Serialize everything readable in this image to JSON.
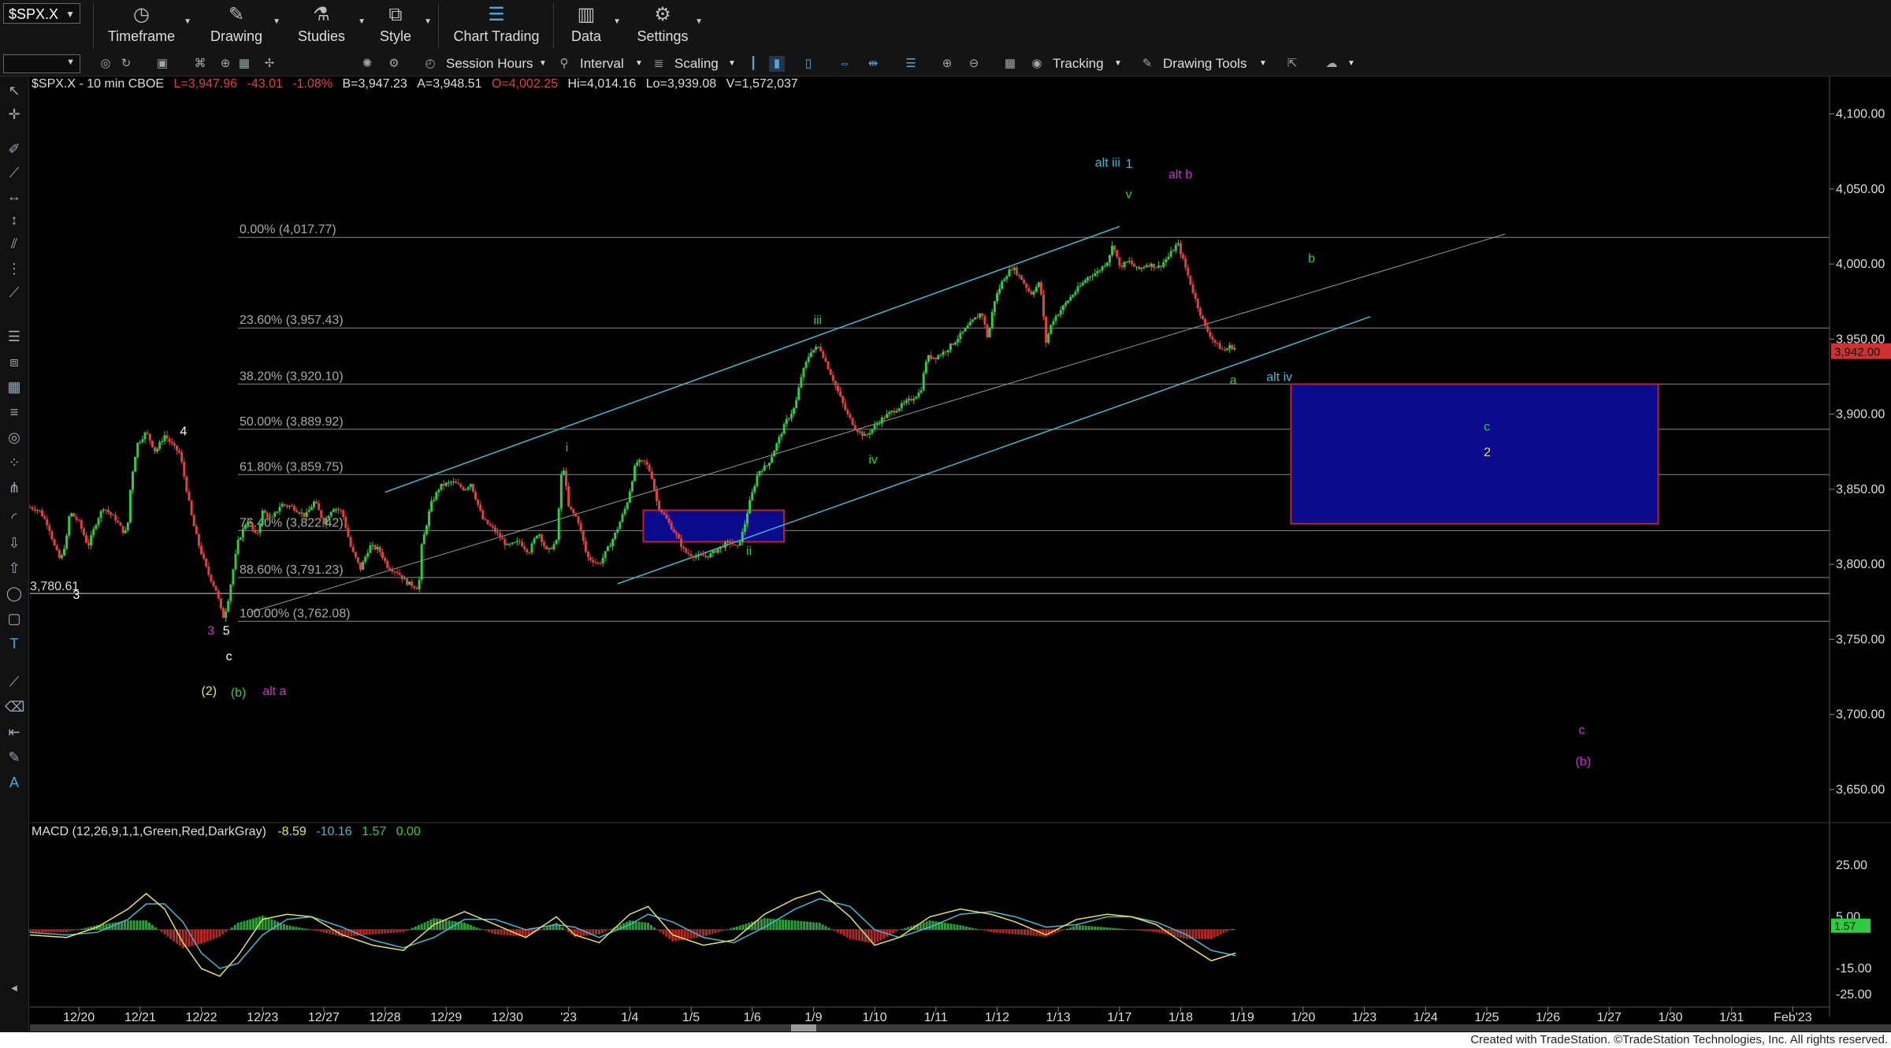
{
  "toolbar": {
    "symbol": "$SPX.X",
    "buttons": [
      {
        "label": "Timeframe",
        "icon": "clock-icon"
      },
      {
        "label": "Drawing",
        "icon": "pen-icon"
      },
      {
        "label": "Studies",
        "icon": "flask-icon"
      },
      {
        "label": "Style",
        "icon": "style-icon"
      },
      {
        "label": "Chart Trading",
        "icon": "chart-trading-icon"
      },
      {
        "label": "Data",
        "icon": "bar-chart-icon"
      },
      {
        "label": "Settings",
        "icon": "gear-icon"
      }
    ]
  },
  "toolbar2": {
    "session": "Session Hours",
    "interval": "Interval",
    "scaling": "Scaling",
    "tracking": "Tracking",
    "drawing_tools": "Drawing Tools"
  },
  "header": {
    "symbol_info": "$SPX.X - 10 min  CBOE",
    "last": "L=3,947.96",
    "change": "-43.01",
    "pct": "-1.08%",
    "bid": "B=3,947.23",
    "ask": "A=3,948.51",
    "open": "O=4,002.25",
    "high": "Hi=4,014.16",
    "low": "Lo=3,939.08",
    "volume": "V=1,572,037"
  },
  "macd_header": {
    "name": "MACD (12,26,9,1,1,Green,Red,DarkGray)",
    "v1": "-8.59",
    "v2": "-10.16",
    "v3": "1.57",
    "v4": "0.00"
  },
  "footer": "Created with TradeStation. ©TradeStation Technologies, Inc. All rights reserved.",
  "colors": {
    "up": "#2ecc40",
    "down": "#e04040",
    "teal": "#44b8d0",
    "magenta": "#d030d0",
    "yellow": "#e8e060",
    "box": "#0a0a8c",
    "boxBorder": "#c02030",
    "lastPrice": "#d03030"
  },
  "chart_data": {
    "type": "candlestick",
    "ylim": [
      3630,
      4115
    ],
    "y_ticks": [
      "4,100.00",
      "4,050.00",
      "4,000.00",
      "3,950.00",
      "3,900.00",
      "3,850.00",
      "3,800.00",
      "3,750.00",
      "3,700.00",
      "3,650.00"
    ],
    "y_tick_values": [
      4100,
      4050,
      4000,
      3950,
      3900,
      3850,
      3800,
      3750,
      3700,
      3650
    ],
    "last_price": 3942,
    "last_price_label": "3,942.00",
    "x_labels": [
      "12/20",
      "12/21",
      "12/22",
      "12/23",
      "12/27",
      "12/28",
      "12/29",
      "12/30",
      "'23",
      "1/4",
      "1/5",
      "1/6",
      "1/9",
      "1/10",
      "1/11",
      "1/12",
      "1/13",
      "1/17",
      "1/18",
      "1/19",
      "1/20",
      "1/23",
      "1/24",
      "1/25",
      "1/26",
      "1/27",
      "1/30",
      "1/31",
      "Feb'23"
    ],
    "x_label_pos": [
      0.2,
      1.2,
      2.2,
      3.2,
      4.2,
      5.2,
      6.2,
      7.2,
      8.2,
      9.2,
      10.2,
      11.2,
      12.2,
      13.2,
      14.2,
      15.2,
      16.2,
      17.2,
      18.2,
      19.2,
      20.2,
      21.2,
      22.2,
      23.2,
      24.2,
      25.2,
      26.2,
      27.2,
      28.2
    ],
    "x_range": [
      -0.6,
      28.8
    ],
    "price_path": [
      [
        -0.6,
        3838
      ],
      [
        -0.45,
        3836
      ],
      [
        -0.3,
        3826
      ],
      [
        -0.2,
        3812
      ],
      [
        -0.1,
        3802
      ],
      [
        0.0,
        3818
      ],
      [
        0.05,
        3835
      ],
      [
        0.2,
        3828
      ],
      [
        0.35,
        3812
      ],
      [
        0.5,
        3830
      ],
      [
        0.6,
        3838
      ],
      [
        0.8,
        3830
      ],
      [
        0.95,
        3820
      ],
      [
        1.0,
        3828
      ],
      [
        1.05,
        3855
      ],
      [
        1.15,
        3880
      ],
      [
        1.3,
        3888
      ],
      [
        1.45,
        3875
      ],
      [
        1.6,
        3886
      ],
      [
        1.75,
        3878
      ],
      [
        1.85,
        3874
      ],
      [
        1.95,
        3852
      ],
      [
        2.05,
        3830
      ],
      [
        2.15,
        3814
      ],
      [
        2.3,
        3795
      ],
      [
        2.45,
        3782
      ],
      [
        2.55,
        3764
      ],
      [
        2.62,
        3772
      ],
      [
        2.7,
        3792
      ],
      [
        2.8,
        3815
      ],
      [
        2.95,
        3830
      ],
      [
        3.1,
        3818
      ],
      [
        3.2,
        3835
      ],
      [
        3.35,
        3830
      ],
      [
        3.5,
        3840
      ],
      [
        3.7,
        3838
      ],
      [
        3.9,
        3832
      ],
      [
        4.05,
        3842
      ],
      [
        4.2,
        3828
      ],
      [
        4.35,
        3838
      ],
      [
        4.5,
        3835
      ],
      [
        4.65,
        3810
      ],
      [
        4.8,
        3797
      ],
      [
        4.95,
        3812
      ],
      [
        5.1,
        3810
      ],
      [
        5.25,
        3798
      ],
      [
        5.4,
        3795
      ],
      [
        5.55,
        3788
      ],
      [
        5.75,
        3784
      ],
      [
        5.8,
        3812
      ],
      [
        5.95,
        3840
      ],
      [
        6.1,
        3852
      ],
      [
        6.3,
        3855
      ],
      [
        6.5,
        3850
      ],
      [
        6.6,
        3854
      ],
      [
        6.8,
        3830
      ],
      [
        7.0,
        3822
      ],
      [
        7.2,
        3812
      ],
      [
        7.4,
        3815
      ],
      [
        7.55,
        3808
      ],
      [
        7.7,
        3822
      ],
      [
        7.85,
        3808
      ],
      [
        8.0,
        3815
      ],
      [
        8.1,
        3870
      ],
      [
        8.2,
        3838
      ],
      [
        8.35,
        3830
      ],
      [
        8.5,
        3805
      ],
      [
        8.7,
        3800
      ],
      [
        8.9,
        3815
      ],
      [
        9.0,
        3824
      ],
      [
        9.15,
        3840
      ],
      [
        9.3,
        3868
      ],
      [
        9.45,
        3868
      ],
      [
        9.55,
        3860
      ],
      [
        9.65,
        3840
      ],
      [
        9.8,
        3830
      ],
      [
        9.95,
        3820
      ],
      [
        10.1,
        3808
      ],
      [
        10.3,
        3805
      ],
      [
        10.5,
        3806
      ],
      [
        10.7,
        3812
      ],
      [
        10.85,
        3815
      ],
      [
        10.95,
        3810
      ],
      [
        11.05,
        3822
      ],
      [
        11.15,
        3840
      ],
      [
        11.3,
        3862
      ],
      [
        11.45,
        3866
      ],
      [
        11.6,
        3880
      ],
      [
        11.75,
        3895
      ],
      [
        11.9,
        3905
      ],
      [
        12.0,
        3925
      ],
      [
        12.15,
        3942
      ],
      [
        12.3,
        3945
      ],
      [
        12.45,
        3930
      ],
      [
        12.6,
        3915
      ],
      [
        12.75,
        3900
      ],
      [
        12.9,
        3890
      ],
      [
        13.05,
        3885
      ],
      [
        13.2,
        3892
      ],
      [
        13.35,
        3898
      ],
      [
        13.5,
        3902
      ],
      [
        13.65,
        3906
      ],
      [
        13.8,
        3910
      ],
      [
        13.95,
        3915
      ],
      [
        14.05,
        3938
      ],
      [
        14.2,
        3938
      ],
      [
        14.35,
        3942
      ],
      [
        14.5,
        3948
      ],
      [
        14.65,
        3955
      ],
      [
        14.8,
        3962
      ],
      [
        14.95,
        3968
      ],
      [
        15.05,
        3950
      ],
      [
        15.15,
        3975
      ],
      [
        15.3,
        3990
      ],
      [
        15.45,
        3998
      ],
      [
        15.6,
        3990
      ],
      [
        15.75,
        3980
      ],
      [
        15.9,
        3988
      ],
      [
        16.0,
        3948
      ],
      [
        16.1,
        3962
      ],
      [
        16.25,
        3970
      ],
      [
        16.4,
        3978
      ],
      [
        16.55,
        3985
      ],
      [
        16.7,
        3992
      ],
      [
        16.85,
        3995
      ],
      [
        17.0,
        4002
      ],
      [
        17.1,
        4014
      ],
      [
        17.2,
        3998
      ],
      [
        17.35,
        4002
      ],
      [
        17.5,
        3996
      ],
      [
        17.65,
        4000
      ],
      [
        17.85,
        3998
      ],
      [
        18.0,
        4005
      ],
      [
        18.15,
        4014
      ],
      [
        18.3,
        3995
      ],
      [
        18.45,
        3975
      ],
      [
        18.6,
        3958
      ],
      [
        18.75,
        3948
      ],
      [
        18.9,
        3942
      ],
      [
        19.0,
        3945
      ],
      [
        19.1,
        3944
      ]
    ],
    "levels": [
      {
        "label": "0.00% (4,017.77)",
        "value": 4017.77
      },
      {
        "label": "23.60% (3,957.43)",
        "value": 3957.43
      },
      {
        "label": "38.20% (3,920.10)",
        "value": 3920.1
      },
      {
        "label": "50.00% (3,889.92)",
        "value": 3889.92
      },
      {
        "label": "61.80% (3,859.75)",
        "value": 3859.75
      },
      {
        "label": "76.40% (3,822.42)",
        "value": 3822.42
      },
      {
        "label": "88.60% (3,791.23)",
        "value": 3791.23
      },
      {
        "label": "100.00% (3,762.08)",
        "value": 3762.08
      }
    ],
    "hline": {
      "label": "3,780.61",
      "value": 3780.61
    },
    "boxes": [
      {
        "x0": 9.42,
        "x1": 11.72,
        "y0": 3836,
        "y1": 3815
      },
      {
        "x0": 20.0,
        "x1": 26.0,
        "y0": 3920,
        "y1": 3827
      }
    ],
    "channel": [
      {
        "x0": 5.2,
        "y0": 3848,
        "x1": 17.2,
        "y1": 4025
      },
      {
        "x0": 9.0,
        "y0": 3787,
        "x1": 21.3,
        "y1": 3965
      }
    ],
    "thin_channel": {
      "x0": 3.0,
      "y0": 3768,
      "x1": 23.5,
      "y1": 4020
    },
    "annotations": [
      {
        "text": "4",
        "x": 1.85,
        "y": 3886,
        "color": "#ffffff"
      },
      {
        "text": "3",
        "x": 0.1,
        "y": 3777,
        "color": "#ffffff"
      },
      {
        "text": "3",
        "x": 2.3,
        "y": 3753,
        "color": "#d030d0"
      },
      {
        "text": "5",
        "x": 2.55,
        "y": 3753,
        "color": "#ffffff"
      },
      {
        "text": "c",
        "x": 2.6,
        "y": 3736,
        "color": "#ffffff"
      },
      {
        "text": "(2)",
        "x": 2.2,
        "y": 3713,
        "color": "#e8e060"
      },
      {
        "text": "(b)",
        "x": 2.68,
        "y": 3712,
        "color": "#2ecc40"
      },
      {
        "text": "alt a",
        "x": 3.2,
        "y": 3713,
        "color": "#d030d0"
      },
      {
        "text": "i",
        "x": 8.15,
        "y": 3875,
        "color": "#2ecc40"
      },
      {
        "text": "ii",
        "x": 11.1,
        "y": 3806,
        "color": "#2ecc40"
      },
      {
        "text": "iii",
        "x": 12.2,
        "y": 3960,
        "color": "#2ecc40"
      },
      {
        "text": "iv",
        "x": 13.1,
        "y": 3867,
        "color": "#2ecc40"
      },
      {
        "text": "alt iii",
        "x": 16.8,
        "y": 4065,
        "color": "#44b8d0"
      },
      {
        "text": "1",
        "x": 17.3,
        "y": 4064,
        "color": "#44b8d0"
      },
      {
        "text": "v",
        "x": 17.3,
        "y": 4044,
        "color": "#2ecc40"
      },
      {
        "text": "alt b",
        "x": 18.0,
        "y": 4057,
        "color": "#d030d0"
      },
      {
        "text": "b",
        "x": 20.28,
        "y": 4001,
        "color": "#2ecc40"
      },
      {
        "text": "a",
        "x": 19.0,
        "y": 3920,
        "color": "#2ecc40"
      },
      {
        "text": "alt iv",
        "x": 19.6,
        "y": 3922,
        "color": "#44b8d0"
      },
      {
        "text": "c",
        "x": 23.15,
        "y": 3889,
        "color": "#2ecc40"
      },
      {
        "text": "2",
        "x": 23.15,
        "y": 3872,
        "color": "#e8e060"
      },
      {
        "text": "c",
        "x": 24.7,
        "y": 3687,
        "color": "#d030d0"
      },
      {
        "text": "(b)",
        "x": 24.65,
        "y": 3666,
        "color": "#d030d0"
      }
    ],
    "macd": {
      "ylim": [
        -29,
        32
      ],
      "ticks": [
        "25.00",
        "5.00",
        "-15.00",
        "-25.00"
      ],
      "tick_values": [
        25,
        5,
        -15,
        -25
      ],
      "last_label": "1.57",
      "last_value": 1.57,
      "x_end": 19.1,
      "macd_line": [
        [
          -0.6,
          -2
        ],
        [
          0.0,
          -3
        ],
        [
          0.5,
          1
        ],
        [
          1.0,
          8
        ],
        [
          1.3,
          14
        ],
        [
          1.6,
          8
        ],
        [
          1.9,
          -5
        ],
        [
          2.2,
          -15
        ],
        [
          2.5,
          -18
        ],
        [
          2.8,
          -10
        ],
        [
          3.2,
          4
        ],
        [
          3.6,
          6
        ],
        [
          4.0,
          5
        ],
        [
          4.5,
          -2
        ],
        [
          5.0,
          -6
        ],
        [
          5.5,
          -8
        ],
        [
          6.0,
          2
        ],
        [
          6.5,
          7
        ],
        [
          7.0,
          2
        ],
        [
          7.5,
          -3
        ],
        [
          8.0,
          5
        ],
        [
          8.3,
          -2
        ],
        [
          8.7,
          -5
        ],
        [
          9.2,
          6
        ],
        [
          9.5,
          9
        ],
        [
          9.9,
          -2
        ],
        [
          10.4,
          -6
        ],
        [
          10.9,
          -4
        ],
        [
          11.4,
          6
        ],
        [
          11.9,
          12
        ],
        [
          12.3,
          15
        ],
        [
          12.8,
          5
        ],
        [
          13.2,
          -6
        ],
        [
          13.6,
          -3
        ],
        [
          14.1,
          5
        ],
        [
          14.6,
          8
        ],
        [
          15.1,
          6
        ],
        [
          15.5,
          3
        ],
        [
          16.0,
          -2
        ],
        [
          16.5,
          4
        ],
        [
          17.0,
          6
        ],
        [
          17.4,
          5
        ],
        [
          17.8,
          2
        ],
        [
          18.3,
          -6
        ],
        [
          18.7,
          -12
        ],
        [
          19.1,
          -9
        ]
      ],
      "signal_line": [
        [
          -0.6,
          -1
        ],
        [
          0.0,
          -2
        ],
        [
          0.5,
          -1
        ],
        [
          1.0,
          4
        ],
        [
          1.3,
          10
        ],
        [
          1.6,
          10
        ],
        [
          1.9,
          3
        ],
        [
          2.2,
          -9
        ],
        [
          2.5,
          -15
        ],
        [
          2.8,
          -13
        ],
        [
          3.2,
          -2
        ],
        [
          3.6,
          4
        ],
        [
          4.0,
          5
        ],
        [
          4.5,
          1
        ],
        [
          5.0,
          -4
        ],
        [
          5.5,
          -7
        ],
        [
          6.0,
          -3
        ],
        [
          6.5,
          4
        ],
        [
          7.0,
          4
        ],
        [
          7.5,
          0
        ],
        [
          8.0,
          2
        ],
        [
          8.3,
          1
        ],
        [
          8.7,
          -3
        ],
        [
          9.2,
          2
        ],
        [
          9.5,
          6
        ],
        [
          9.9,
          3
        ],
        [
          10.4,
          -3
        ],
        [
          10.9,
          -5
        ],
        [
          11.4,
          1
        ],
        [
          11.9,
          8
        ],
        [
          12.3,
          12
        ],
        [
          12.8,
          9
        ],
        [
          13.2,
          0
        ],
        [
          13.6,
          -3
        ],
        [
          14.1,
          1
        ],
        [
          14.6,
          6
        ],
        [
          15.1,
          7
        ],
        [
          15.5,
          5
        ],
        [
          16.0,
          1
        ],
        [
          16.5,
          2
        ],
        [
          17.0,
          5
        ],
        [
          17.4,
          5
        ],
        [
          17.8,
          3
        ],
        [
          18.3,
          -2
        ],
        [
          18.7,
          -8
        ],
        [
          19.1,
          -10
        ]
      ]
    }
  }
}
